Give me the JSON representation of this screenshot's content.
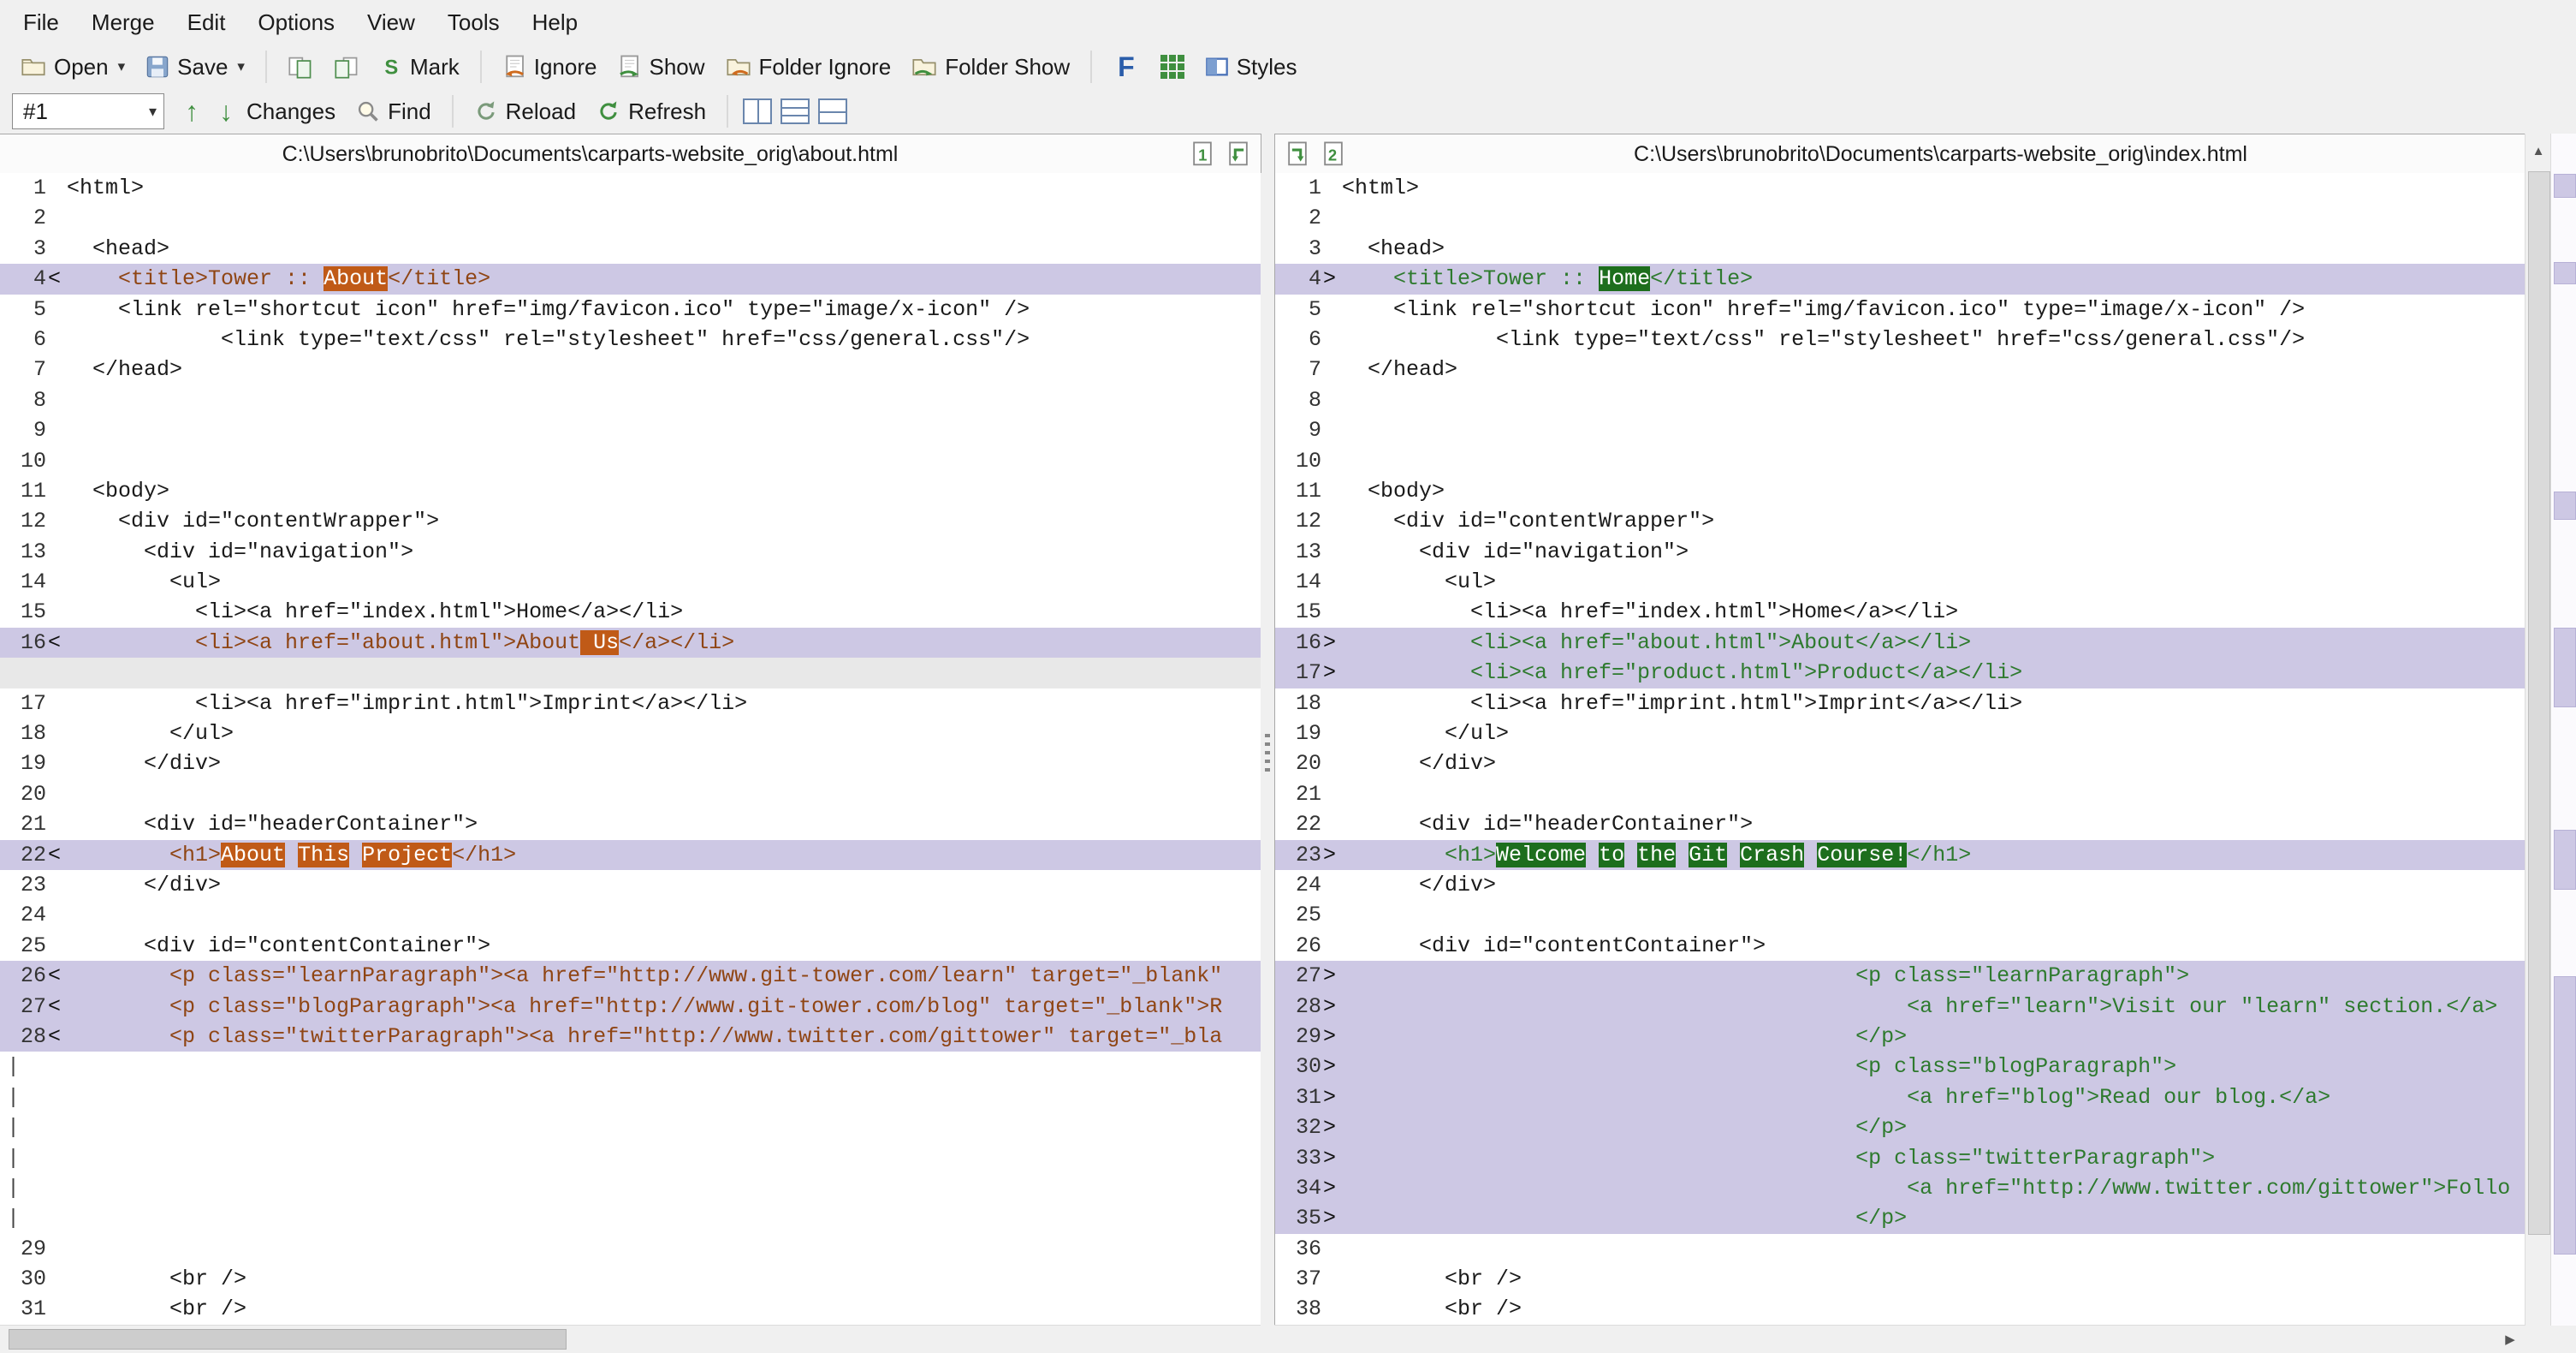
{
  "menu": {
    "items": [
      "File",
      "Merge",
      "Edit",
      "Options",
      "View",
      "Tools",
      "Help"
    ]
  },
  "toolbar": {
    "open_label": "Open",
    "save_label": "Save",
    "mark_label": "Mark",
    "ignore_label": "Ignore",
    "show_label": "Show",
    "folder_ignore_label": "Folder Ignore",
    "folder_show_label": "Folder Show",
    "styles_label": "Styles"
  },
  "nav_toolbar": {
    "diff_number": "#1",
    "changes_label": "Changes",
    "find_label": "Find",
    "reload_label": "Reload",
    "refresh_label": "Refresh"
  },
  "files": {
    "left_path": "C:\\Users\\brunobrito\\Documents\\carparts-website_orig\\about.html",
    "right_path": "C:\\Users\\brunobrito\\Documents\\carparts-website_orig\\index.html",
    "left_pane_number": "1",
    "right_pane_number": "2"
  },
  "icons": {
    "open": "folder-icon",
    "save": "floppy-disk-icon",
    "copy_pair": "document-pair-icon",
    "mark": "green-s-icon",
    "ignore": "document-orange-arrow-icon",
    "show": "document-green-arrow-icon",
    "folder_ignore": "folder-orange-arrow-icon",
    "folder_show": "folder-green-arrow-icon",
    "font": "blue-F-icon",
    "grid": "green-grid-icon",
    "styles": "split-rectangle-icon",
    "prev_change": "up-arrow",
    "next_change": "down-arrow",
    "find": "magnifier-icon",
    "reload": "circular-arrow-icon",
    "refresh": "circular-arrow-icon"
  },
  "colors": {
    "toolbar_bg": "#f0f0f0",
    "diff_line_bg": "#cdc8e4",
    "left_diff_text": "#8f4514",
    "left_word_diff_bg": "#c05a17",
    "right_diff_text": "#2e7a2e",
    "right_word_diff_bg": "#1d6e1d",
    "gap_row_bg": "#e8e8e8",
    "accent_green": "#3f8f3f"
  },
  "left_pane": {
    "lines": [
      {
        "num": "1",
        "text": "<html>"
      },
      {
        "num": "2",
        "text": ""
      },
      {
        "num": "3",
        "text": "  <head>"
      },
      {
        "num": "4",
        "marker": "<",
        "kind": "diff",
        "segments": [
          [
            "    <title>Tower :: ",
            0
          ],
          [
            "About",
            1
          ],
          [
            "</title>",
            0
          ]
        ]
      },
      {
        "num": "5",
        "text": "    <link rel=\"shortcut icon\" href=\"img/favicon.ico\" type=\"image/x-icon\" />"
      },
      {
        "num": "6",
        "text": "            <link type=\"text/css\" rel=\"stylesheet\" href=\"css/general.css\"/>"
      },
      {
        "num": "7",
        "text": "  </head>"
      },
      {
        "num": "8",
        "text": ""
      },
      {
        "num": "9",
        "text": ""
      },
      {
        "num": "10",
        "text": ""
      },
      {
        "num": "11",
        "text": "  <body>"
      },
      {
        "num": "12",
        "text": "    <div id=\"contentWrapper\">"
      },
      {
        "num": "13",
        "text": "      <div id=\"navigation\">"
      },
      {
        "num": "14",
        "text": "        <ul>"
      },
      {
        "num": "15",
        "text": "          <li><a href=\"index.html\">Home</a></li>"
      },
      {
        "num": "16",
        "marker": "<",
        "kind": "diff",
        "segments": [
          [
            "          <li><a href=\"about.html\">About",
            0
          ],
          [
            " Us",
            1
          ],
          [
            "</a></li>",
            0
          ]
        ]
      },
      {
        "kind": "gap"
      },
      {
        "num": "17",
        "text": "          <li><a href=\"imprint.html\">Imprint</a></li>"
      },
      {
        "num": "18",
        "text": "        </ul>"
      },
      {
        "num": "19",
        "text": "      </div>"
      },
      {
        "num": "20",
        "text": ""
      },
      {
        "num": "21",
        "text": "      <div id=\"headerContainer\">"
      },
      {
        "num": "22",
        "marker": "<",
        "kind": "diff",
        "segments": [
          [
            "        <h1>",
            0
          ],
          [
            "About",
            1
          ],
          [
            " ",
            0
          ],
          [
            "This",
            1
          ],
          [
            " ",
            0
          ],
          [
            "Project",
            1
          ],
          [
            "</h1>",
            0
          ]
        ]
      },
      {
        "num": "23",
        "text": "      </div>"
      },
      {
        "num": "24",
        "text": ""
      },
      {
        "num": "25",
        "text": "      <div id=\"contentContainer\">"
      },
      {
        "num": "26",
        "marker": "<",
        "kind": "diff",
        "segments": [
          [
            "        <p class=\"learnParagraph\"><a href=\"http://www.git-tower.com/learn\" target=\"_blank\"",
            0
          ]
        ]
      },
      {
        "num": "27",
        "marker": "<",
        "kind": "diff",
        "segments": [
          [
            "        <p class=\"blogParagraph\"><a href=\"http://www.git-tower.com/blog\" target=\"_blank\">R",
            0
          ]
        ]
      },
      {
        "num": "28",
        "marker": "<",
        "kind": "diff",
        "segments": [
          [
            "        <p class=\"twitterParagraph\"><a href=\"http://www.twitter.com/gittower\" target=\"_bla",
            0
          ]
        ]
      },
      {
        "kind": "gap2"
      },
      {
        "kind": "gap2"
      },
      {
        "kind": "gap2"
      },
      {
        "kind": "gap2"
      },
      {
        "kind": "gap2"
      },
      {
        "kind": "gap2"
      },
      {
        "num": "29",
        "text": ""
      },
      {
        "num": "30",
        "text": "        <br />"
      },
      {
        "num": "31",
        "text": "        <br />"
      }
    ]
  },
  "right_pane": {
    "lines": [
      {
        "num": "1",
        "text": "<html>"
      },
      {
        "num": "2",
        "text": ""
      },
      {
        "num": "3",
        "text": "  <head>"
      },
      {
        "num": "4",
        "marker": ">",
        "kind": "diff",
        "segments": [
          [
            "    <title>Tower :: ",
            0
          ],
          [
            "Home",
            1
          ],
          [
            "</title>",
            0
          ]
        ]
      },
      {
        "num": "5",
        "text": "    <link rel=\"shortcut icon\" href=\"img/favicon.ico\" type=\"image/x-icon\" />"
      },
      {
        "num": "6",
        "text": "            <link type=\"text/css\" rel=\"stylesheet\" href=\"css/general.css\"/>"
      },
      {
        "num": "7",
        "text": "  </head>"
      },
      {
        "num": "8",
        "text": ""
      },
      {
        "num": "9",
        "text": ""
      },
      {
        "num": "10",
        "text": ""
      },
      {
        "num": "11",
        "text": "  <body>"
      },
      {
        "num": "12",
        "text": "    <div id=\"contentWrapper\">"
      },
      {
        "num": "13",
        "text": "      <div id=\"navigation\">"
      },
      {
        "num": "14",
        "text": "        <ul>"
      },
      {
        "num": "15",
        "text": "          <li><a href=\"index.html\">Home</a></li>"
      },
      {
        "num": "16",
        "marker": ">",
        "kind": "diff",
        "segments": [
          [
            "          <li><a href=\"about.html\">About</a></li>",
            0
          ]
        ]
      },
      {
        "num": "17",
        "marker": ">",
        "kind": "diff",
        "segments": [
          [
            "          <li><a href=\"product.html\">Product</a></li>",
            0
          ]
        ]
      },
      {
        "num": "18",
        "text": "          <li><a href=\"imprint.html\">Imprint</a></li>"
      },
      {
        "num": "19",
        "text": "        </ul>"
      },
      {
        "num": "20",
        "text": "      </div>"
      },
      {
        "num": "21",
        "text": ""
      },
      {
        "num": "22",
        "text": "      <div id=\"headerContainer\">"
      },
      {
        "num": "23",
        "marker": ">",
        "kind": "diff",
        "segments": [
          [
            "        <h1>",
            0
          ],
          [
            "Welcome",
            1
          ],
          [
            " ",
            0
          ],
          [
            "to",
            1
          ],
          [
            " ",
            0
          ],
          [
            "the",
            1
          ],
          [
            " ",
            0
          ],
          [
            "Git",
            1
          ],
          [
            " ",
            0
          ],
          [
            "Crash",
            1
          ],
          [
            " ",
            0
          ],
          [
            "Course!",
            1
          ],
          [
            "</h1>",
            0
          ]
        ]
      },
      {
        "num": "24",
        "text": "      </div>"
      },
      {
        "num": "25",
        "text": ""
      },
      {
        "num": "26",
        "text": "      <div id=\"contentContainer\">"
      },
      {
        "num": "27",
        "marker": ">",
        "kind": "diff",
        "segments": [
          [
            "                                        <p class=\"learnParagraph\">",
            0
          ]
        ]
      },
      {
        "num": "28",
        "marker": ">",
        "kind": "diff",
        "segments": [
          [
            "                                            <a href=\"learn\">Visit our \"learn\" section.</a>",
            0
          ]
        ]
      },
      {
        "num": "29",
        "marker": ">",
        "kind": "diff",
        "segments": [
          [
            "                                        </p>",
            0
          ]
        ]
      },
      {
        "num": "30",
        "marker": ">",
        "kind": "diff",
        "segments": [
          [
            "                                        <p class=\"blogParagraph\">",
            0
          ]
        ]
      },
      {
        "num": "31",
        "marker": ">",
        "kind": "diff",
        "segments": [
          [
            "                                            <a href=\"blog\">Read our blog.</a>",
            0
          ]
        ]
      },
      {
        "num": "32",
        "marker": ">",
        "kind": "diff",
        "segments": [
          [
            "                                        </p>",
            0
          ]
        ]
      },
      {
        "num": "33",
        "marker": ">",
        "kind": "diff",
        "segments": [
          [
            "                                        <p class=\"twitterParagraph\">",
            0
          ]
        ]
      },
      {
        "num": "34",
        "marker": ">",
        "kind": "diff",
        "segments": [
          [
            "                                            <a href=\"http://www.twitter.com/gittower\">Follo",
            0
          ]
        ]
      },
      {
        "num": "35",
        "marker": ">",
        "kind": "diff",
        "segments": [
          [
            "                                        </p>",
            0
          ]
        ]
      },
      {
        "num": "36",
        "text": ""
      },
      {
        "num": "37",
        "text": "        <br />"
      },
      {
        "num": "38",
        "text": "        <br />"
      }
    ]
  }
}
